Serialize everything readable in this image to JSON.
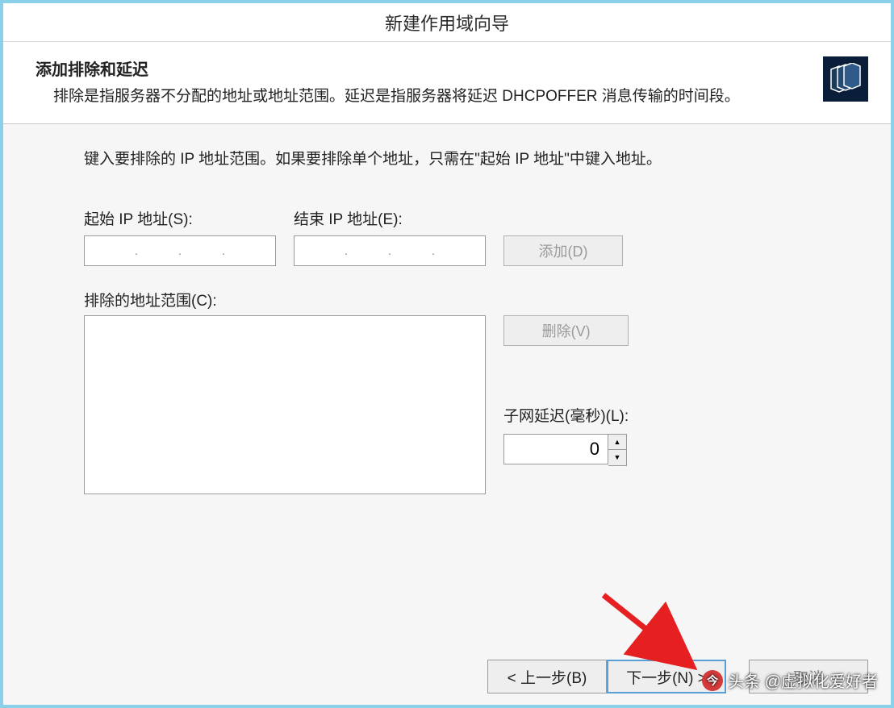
{
  "window": {
    "title": "新建作用域向导"
  },
  "header": {
    "title": "添加排除和延迟",
    "description": "排除是指服务器不分配的地址或地址范围。延迟是指服务器将延迟 DHCPOFFER 消息传输的时间段。"
  },
  "content": {
    "instruction": "键入要排除的 IP 地址范围。如果要排除单个地址，只需在\"起始 IP 地址\"中键入地址。",
    "start_ip_label": "起始 IP 地址(S):",
    "end_ip_label": "结束 IP 地址(E):",
    "add_button": "添加(D)",
    "excluded_label": "排除的地址范围(C):",
    "remove_button": "删除(V)",
    "delay_label": "子网延迟(毫秒)(L):",
    "delay_value": "0"
  },
  "footer": {
    "back_button": "< 上一步(B)",
    "next_button": "下一步(N) >",
    "cancel_button": "取消"
  },
  "watermark": {
    "text": "头条 @虚拟化爱好者"
  }
}
